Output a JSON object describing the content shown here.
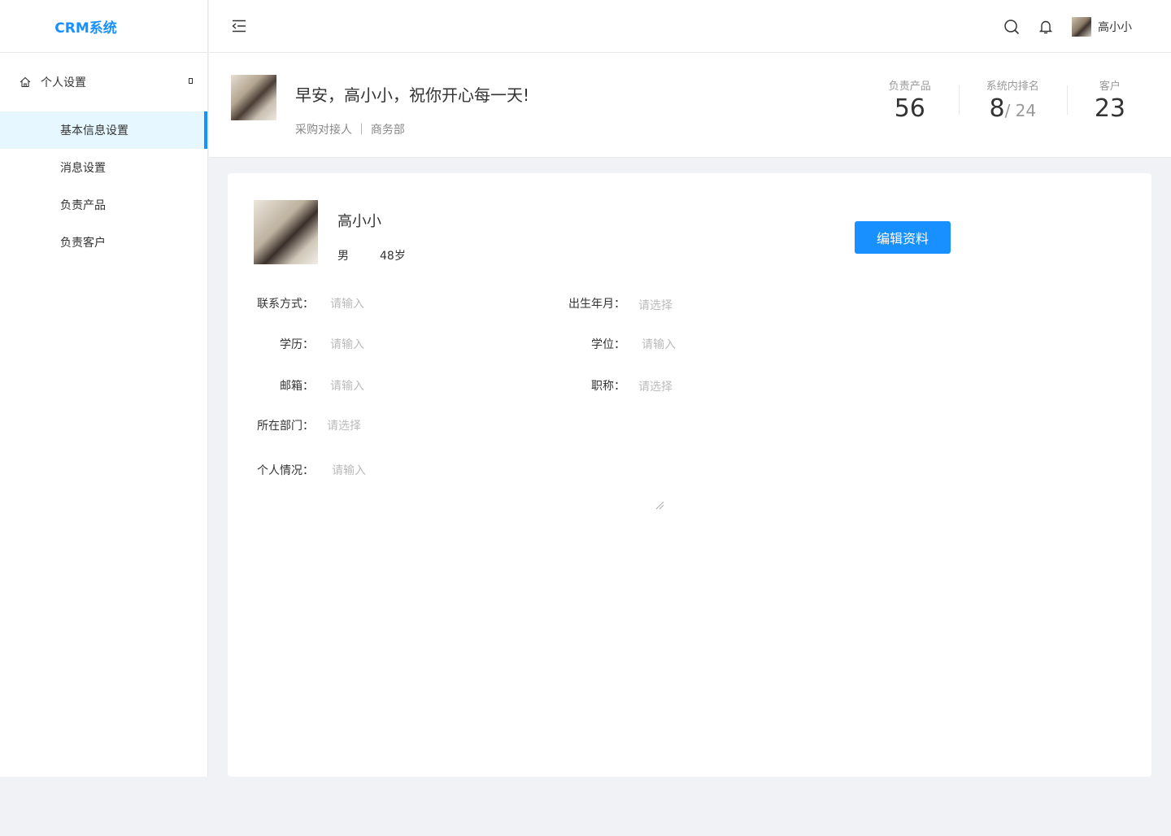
{
  "app": {
    "title": "CRM系统"
  },
  "sidebar": {
    "group_label": "个人设置",
    "items": [
      {
        "label": "基本信息设置",
        "active": true
      },
      {
        "label": "消息设置"
      },
      {
        "label": "负责产品"
      },
      {
        "label": "负责客户"
      }
    ]
  },
  "topbar": {
    "username": "高小小"
  },
  "welcome": {
    "greeting": "早安，高小小，祝你开心每一天!",
    "role": "采购对接人 ｜ 商务部",
    "stats": [
      {
        "label": "负责产品",
        "value": "56"
      },
      {
        "label": "系统内排名",
        "value": "8",
        "total": "/ 24"
      },
      {
        "label": "客户",
        "value": "23"
      }
    ]
  },
  "profile": {
    "name": "高小小",
    "gender": "男",
    "age": "48岁",
    "edit_label": "编辑资料",
    "fields": {
      "contact": {
        "label": "联系方式：",
        "placeholder": "请输入"
      },
      "birth": {
        "label": "出生年月：",
        "placeholder": "请选择"
      },
      "education": {
        "label": "学历：",
        "placeholder": "请输入"
      },
      "degree": {
        "label": "学位：",
        "placeholder": "请输入"
      },
      "email": {
        "label": "邮箱：",
        "placeholder": "请输入"
      },
      "title": {
        "label": "职称：",
        "placeholder": "请选择"
      },
      "department": {
        "label": "所在部门：",
        "placeholder": "请选择"
      },
      "bio": {
        "label": "个人情况：",
        "placeholder": "请输入"
      }
    }
  },
  "colors": {
    "accent": "#1890ff",
    "active_bg": "#e6f7ff",
    "page_bg": "#f0f2f5"
  }
}
